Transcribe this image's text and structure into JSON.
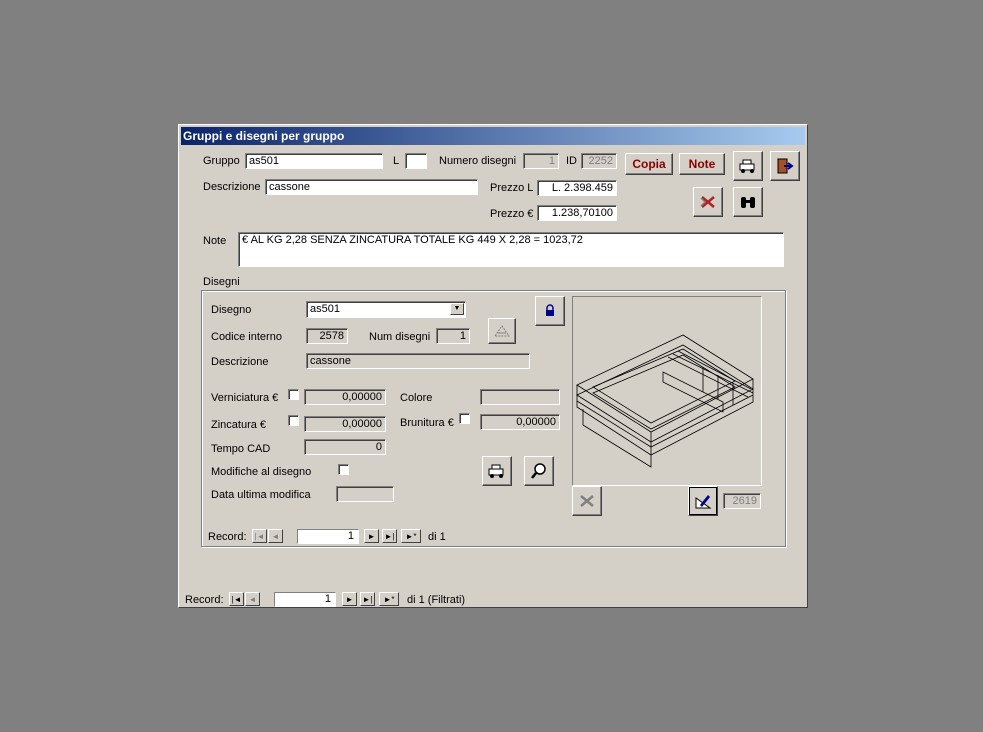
{
  "window": {
    "title": "Gruppi e disegni per gruppo"
  },
  "form": {
    "gruppo_label": "Gruppo",
    "gruppo_value": "as501",
    "l_label": "L",
    "l_value": "",
    "numero_disegni_label": "Numero disegni",
    "numero_disegni_value": "1",
    "id_label": "ID",
    "id_value": "2252",
    "descrizione_label": "Descrizione",
    "descrizione_value": "cassone",
    "prezzo_l_label": "Prezzo L",
    "prezzo_l_value": "L. 2.398.459",
    "prezzo_eur_label": "Prezzo €",
    "prezzo_eur_value": "1.238,70100",
    "note_label": "Note",
    "note_value": "€ AL KG 2,28 SENZA ZINCATURA TOTALE  KG 449 X 2,28 = 1023,72",
    "copia_button": "Copia",
    "note_button": "Note"
  },
  "disegni": {
    "section_label": "Disegni",
    "disegno_label": "Disegno",
    "disegno_value": "as501",
    "codice_label": "Codice interno",
    "codice_value": "2578",
    "num_disegni_label": "Num disegni",
    "num_disegni_value": "1",
    "descrizione_label": "Descrizione",
    "descrizione_value": "cassone",
    "verniciatura_label": "Verniciatura €",
    "verniciatura_value": "0,00000",
    "colore_label": "Colore",
    "colore_value": "",
    "zincatura_label": "Zincatura €",
    "zincatura_value": "0,00000",
    "brunitura_label": "Brunitura €",
    "brunitura_value": "0,00000",
    "tempo_cad_label": "Tempo CAD",
    "tempo_cad_value": "0",
    "modifiche_label": "Modifiche al disegno",
    "data_modifica_label": "Data ultima modifica",
    "data_modifica_value": "",
    "image_id_value": "2619",
    "record_label": "Record:",
    "record_value": "1",
    "record_total": "di 1"
  },
  "main_nav": {
    "record_label": "Record:",
    "record_value": "1",
    "record_total": "di 1 (Filtrati)"
  },
  "nav_glyphs": {
    "first": "|◄",
    "prev": "◄",
    "next": "►",
    "last": "►|",
    "new": "►*"
  },
  "icons": {
    "dropdown": "▼",
    "lock": "🔒",
    "binoculars": "👓",
    "delete": "✗",
    "exit": "⇥",
    "search": "⌕"
  },
  "colors": {
    "title_start": "#0a246a",
    "title_end": "#a6caf0",
    "accent_text": "#8b0000"
  }
}
